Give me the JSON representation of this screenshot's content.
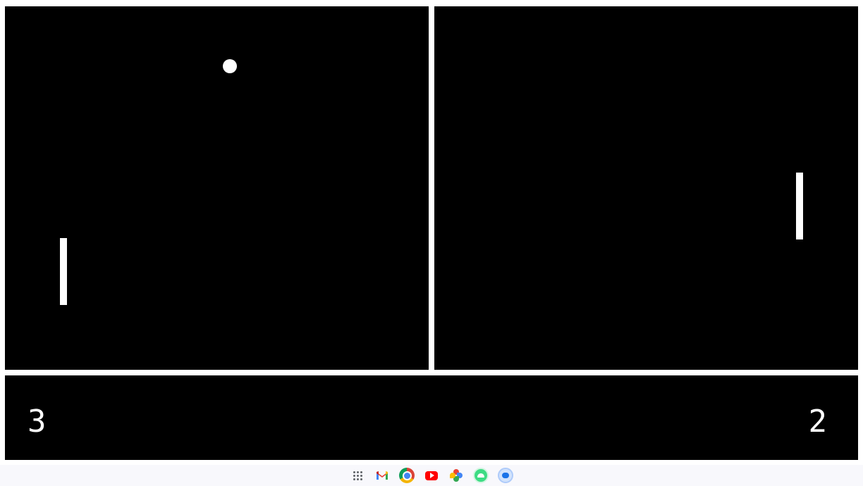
{
  "game": {
    "left_score": "3",
    "right_score": "2"
  },
  "colors": {
    "field": "#000000",
    "foreground": "#ffffff",
    "border": "#ffffff"
  },
  "shelf": {
    "apps": [
      {
        "name": "launcher-icon"
      },
      {
        "name": "gmail-icon"
      },
      {
        "name": "chrome-icon"
      },
      {
        "name": "youtube-icon"
      },
      {
        "name": "photos-icon"
      },
      {
        "name": "android-icon"
      },
      {
        "name": "messages-icon"
      }
    ]
  }
}
